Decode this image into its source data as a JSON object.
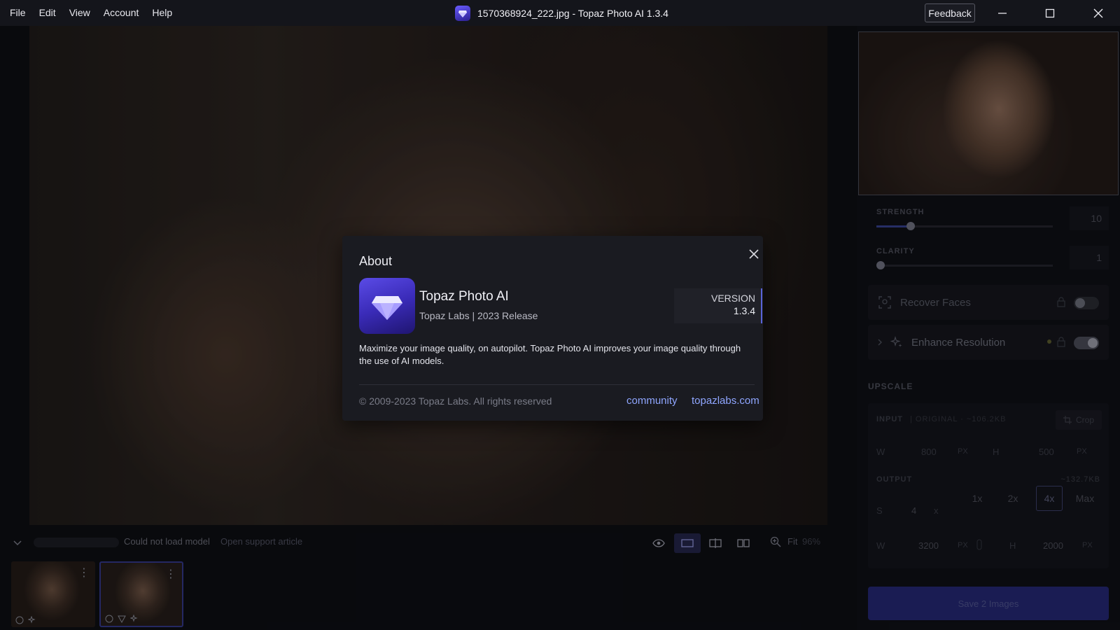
{
  "menu": [
    "File",
    "Edit",
    "View",
    "Account",
    "Help"
  ],
  "window_title": "1570368924_222.jpg - Topaz Photo AI 1.3.4",
  "feedback_label": "Feedback",
  "right_panel": {
    "strength_label": "STRENGTH",
    "strength_value": "10",
    "strength_level": 0.1,
    "clarity_label": "CLARITY",
    "clarity_value": "1",
    "clarity_level": 0.0,
    "recover_faces_label": "Recover Faces",
    "enhance_resolution_label": "Enhance Resolution",
    "upscale_title": "UPSCALE",
    "input_label": "INPUT",
    "input_meta": "| ORIGINAL · ~106.2KB",
    "crop_label": "Crop",
    "input_w_label": "W",
    "input_w": "800",
    "input_h_label": "H",
    "input_h": "500",
    "px": "PX",
    "output_label": "OUTPUT",
    "output_size": "~132.7KB",
    "scale_label": "S",
    "scale_value": "4",
    "scale_unit": "x",
    "scale_options": [
      "1x",
      "2x",
      "4x",
      "Max"
    ],
    "output_w_label": "W",
    "output_w": "3200",
    "output_h_label": "H",
    "output_h": "2000",
    "save_label": "Save 2 Images"
  },
  "bottom": {
    "status_text": "Could not load model",
    "support_link": "Open support article",
    "zoom_label": "Fit",
    "zoom_value": "96%"
  },
  "about": {
    "title": "About",
    "app_name": "Topaz Photo AI",
    "app_sub": "Topaz Labs | 2023 Release",
    "version_label": "VERSION",
    "version": "1.3.4",
    "description": "Maximize your image quality, on autopilot. Topaz Photo AI improves your image quality through the use of AI models.",
    "copyright": "© 2009-2023 Topaz Labs. All rights reserved",
    "link_community": "community",
    "link_site": "topazlabs.com"
  },
  "colors": {
    "accent": "#5a63d8",
    "link": "#8fa6ff",
    "save_button": "#242874"
  }
}
